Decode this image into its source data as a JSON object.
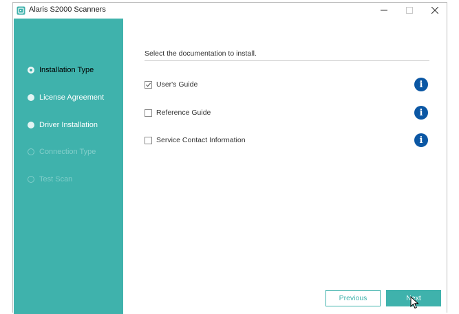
{
  "window": {
    "title": "Alaris S2000 Scanners",
    "controls": [
      "minimize",
      "maximize",
      "close"
    ]
  },
  "sidebar": {
    "steps": [
      {
        "label": "Installation Type",
        "state": "current"
      },
      {
        "label": "License Agreement",
        "state": "done"
      },
      {
        "label": "Driver Installation",
        "state": "done"
      },
      {
        "label": "Connection Type",
        "state": "pending"
      },
      {
        "label": "Test Scan",
        "state": "pending"
      }
    ]
  },
  "main": {
    "instruction": "Select the documentation to install.",
    "options": [
      {
        "label": "User's Guide",
        "checked": true,
        "info_icon": "i"
      },
      {
        "label": "Reference Guide",
        "checked": false,
        "info_icon": "i"
      },
      {
        "label": "Service Contact Information",
        "checked": false,
        "info_icon": "i"
      }
    ]
  },
  "footer": {
    "previous_label": "Previous",
    "next_label": "Next"
  },
  "colors": {
    "accent": "#3fb2ac",
    "info": "#0b57a4",
    "pending_text": "#82ceca"
  }
}
